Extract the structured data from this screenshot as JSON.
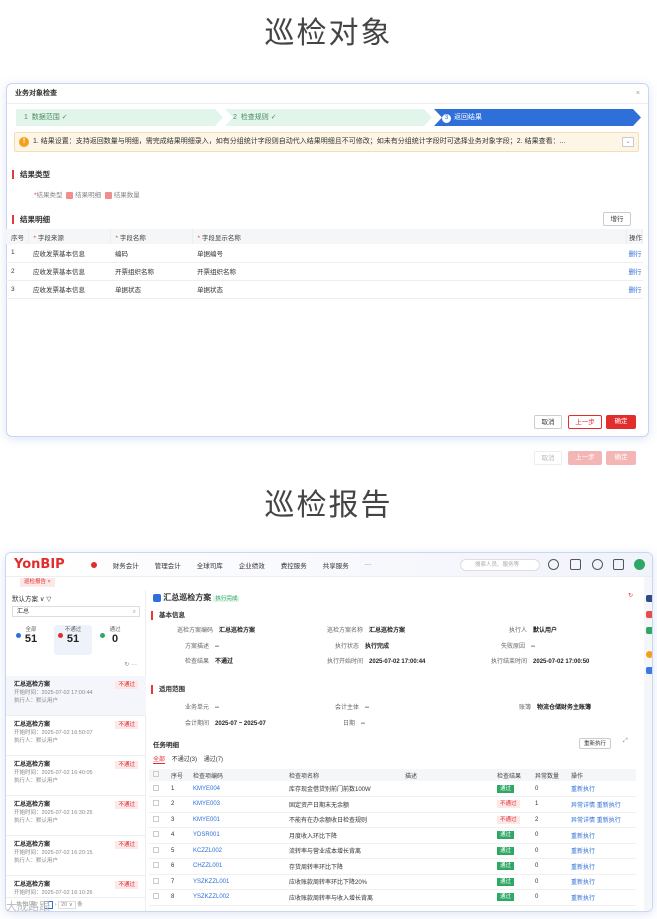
{
  "headings": {
    "object": "巡检对象",
    "report": "巡检报告"
  },
  "dialog": {
    "title": "业务对象检查",
    "close": "×",
    "steps": [
      {
        "num": "1",
        "label": "数据范围",
        "check": "✓"
      },
      {
        "num": "2",
        "label": "检查规则",
        "check": "✓"
      },
      {
        "num": "3",
        "label": "返回结果",
        "check": ""
      }
    ],
    "notice": "1. 结果设置：支持返回数量与明细，需完成结果明细录入，如有分组统计字段则自动代入结果明细且不可修改；如未有分组统计字段时可选择业务对象字段；2. 结果查看：...",
    "result_type": {
      "title": "结果类型",
      "label": "结果类型",
      "options": [
        "结果明细",
        "结果数量"
      ]
    },
    "result_detail": {
      "title": "结果明细",
      "add_label": "增行"
    },
    "columns": [
      "序号",
      "字段来源",
      "字段名称",
      "字段显示名称",
      "操作"
    ],
    "rows": [
      {
        "no": "1",
        "source": "应收发票基本信息",
        "field": "编码",
        "display": "单据编号",
        "op": "删行"
      },
      {
        "no": "2",
        "source": "应收发票基本信息",
        "field": "开票组织名称",
        "display": "开票组织名称",
        "op": "删行"
      },
      {
        "no": "3",
        "source": "应收发票基本信息",
        "field": "单据状态",
        "display": "单据状态",
        "op": "删行"
      }
    ],
    "buttons": {
      "cancel": "取消",
      "prev": "上一步",
      "confirm": "确定"
    }
  },
  "app": {
    "logo_a": "YonBIP",
    "menus": [
      "财务会计",
      "管理会计",
      "全球司库",
      "企业绩效",
      "费控服务",
      "共享服务",
      "···"
    ],
    "search_placeholder": "搜索人员、服务等",
    "tab": "巡检报告 ×",
    "left": {
      "scheme": "默认方案 ∨",
      "filter_icon": "▽",
      "search_value": "汇总",
      "stats": [
        {
          "label": "全部",
          "value": "51",
          "color": "#2f6fd9"
        },
        {
          "label": "不通过",
          "value": "51",
          "color": "#e22d2d"
        },
        {
          "label": "通过",
          "value": "0",
          "color": "#2ea864"
        }
      ],
      "items": [
        {
          "title": "汇总巡检方案",
          "start": "开始时间：2025-07-02 17:00:44",
          "exec": "执行人：默认用户",
          "tag": "不通过"
        },
        {
          "title": "汇总巡检方案",
          "start": "开始时间：2025-07-02 16:50:07",
          "exec": "执行人：默认用户",
          "tag": "不通过"
        },
        {
          "title": "汇总巡检方案",
          "start": "开始时间：2025-07-02 16:40:05",
          "exec": "执行人：默认用户",
          "tag": "不通过"
        },
        {
          "title": "汇总巡检方案",
          "start": "开始时间：2025-07-02 16:30:25",
          "exec": "执行人：默认用户",
          "tag": "不通过"
        },
        {
          "title": "汇总巡检方案",
          "start": "开始时间：2025-07-02 16:20:15",
          "exec": "执行人：默认用户",
          "tag": "不通过"
        },
        {
          "title": "汇总巡检方案",
          "start": "开始时间：2025-07-02 16:10:26",
          "exec": "执行人：默认用户",
          "tag": "不通过"
        }
      ],
      "footer_total": "共 51 条",
      "page": "1",
      "page_size": "20 ∨",
      "page_unit": "条"
    },
    "main": {
      "title": "汇总巡检方案",
      "status": "执行完成",
      "basic_title": "基本信息",
      "basic": [
        {
          "k": "巡检方案编码",
          "v": "汇总巡检方案"
        },
        {
          "k": "巡检方案名称",
          "v": "汇总巡检方案"
        },
        {
          "k": "执行人",
          "v": "默认用户"
        },
        {
          "k": "方案描述",
          "v": "--"
        },
        {
          "k": "执行状态",
          "v": "执行完成"
        },
        {
          "k": "失败原因",
          "v": "--"
        },
        {
          "k": "检查结果",
          "v": "不通过"
        },
        {
          "k": "执行开始时间",
          "v": "2025-07-02 17:00:44"
        },
        {
          "k": "执行结束时间",
          "v": "2025-07-02 17:00:50"
        }
      ],
      "scope_title": "适用范围",
      "scope": [
        {
          "k": "业务单元",
          "v": "--"
        },
        {
          "k": "会计主体",
          "v": "--"
        },
        {
          "k": "账簿",
          "v": "物流仓储财务主账簿"
        },
        {
          "k": "会计期间",
          "v": "2025-07 ~ 2025-07"
        },
        {
          "k": "日期",
          "v": "--"
        }
      ],
      "task_title": "任务明细",
      "rerun": "重新执行",
      "filters": [
        "全部",
        "不通过(3)",
        "通过(7)"
      ],
      "columns": [
        "序号",
        "检查项编码",
        "检查项名称",
        "描述",
        "检查结果",
        "异常数量",
        "操作"
      ],
      "rows": [
        {
          "no": "1",
          "code": "KMYE004",
          "name": "库存现金借贷别前门前数100W",
          "desc": "",
          "result": "通过",
          "pass": true,
          "count": "0",
          "op1": "",
          "op2": "重新执行"
        },
        {
          "no": "2",
          "code": "KMYE003",
          "name": "固定资产日期末无余额",
          "desc": "",
          "result": "不通过",
          "pass": false,
          "count": "1",
          "op1": "异常详情",
          "op2": "重新执行"
        },
        {
          "no": "3",
          "code": "KMYE001",
          "name": "不能有在办余额收日检查规则",
          "desc": "",
          "result": "不通过",
          "pass": false,
          "count": "2",
          "op1": "异常详情",
          "op2": "重新执行"
        },
        {
          "no": "4",
          "code": "YDSR001",
          "name": "月度收入环比下降",
          "desc": "",
          "result": "通过",
          "pass": true,
          "count": "0",
          "op1": "",
          "op2": "重新执行"
        },
        {
          "no": "5",
          "code": "KCZZL002",
          "name": "流转率与营业成本增长背离",
          "desc": "",
          "result": "通过",
          "pass": true,
          "count": "0",
          "op1": "",
          "op2": "重新执行"
        },
        {
          "no": "6",
          "code": "CHZZL001",
          "name": "存货周转率环比下降",
          "desc": "",
          "result": "通过",
          "pass": true,
          "count": "0",
          "op1": "",
          "op2": "重新执行"
        },
        {
          "no": "7",
          "code": "YSZKZZL001",
          "name": "应收账款周转率环比下降20%",
          "desc": "",
          "result": "通过",
          "pass": true,
          "count": "0",
          "op1": "",
          "op2": "重新执行"
        },
        {
          "no": "8",
          "code": "YSZKZZL002",
          "name": "应收账款周转率与收入增长背离",
          "desc": "",
          "result": "通过",
          "pass": true,
          "count": "0",
          "op1": "",
          "op2": "重新执行"
        }
      ]
    }
  },
  "watermark": "大成路跟"
}
